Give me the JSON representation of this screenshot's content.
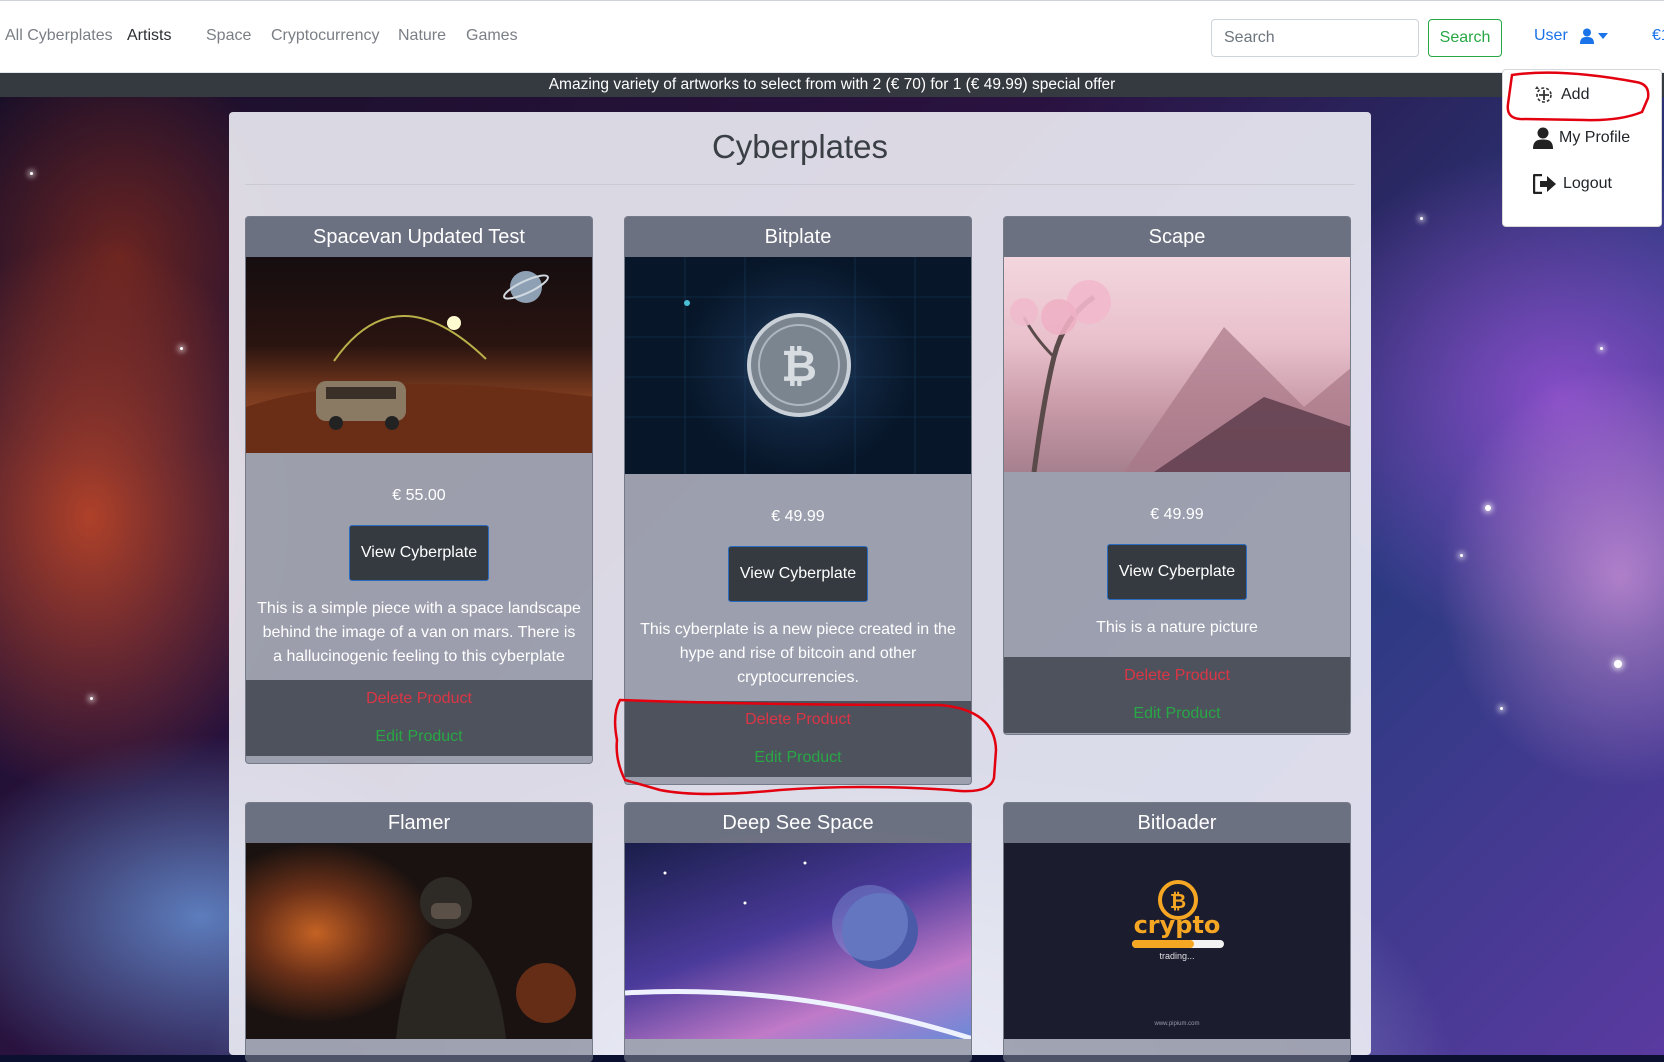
{
  "navbar": {
    "links": [
      {
        "label": "All Cyberplates",
        "active": false
      },
      {
        "label": "Artists",
        "active": true
      },
      {
        "label": "Space",
        "active": false
      },
      {
        "label": "Cryptocurrency",
        "active": false
      },
      {
        "label": "Nature",
        "active": false
      },
      {
        "label": "Games",
        "active": false
      }
    ],
    "search_placeholder": "Search",
    "search_button": "Search",
    "user_label": "User",
    "currency_cut": "€1"
  },
  "banner": {
    "text": "Amazing variety of artworks to select from with 2 (€ 70) for 1 (€ 49.99) special offer"
  },
  "main": {
    "title": "Cyberplates",
    "products": [
      {
        "name": "Spacevan Updated Test",
        "price": "€ 55.00",
        "view_label": "View Cyberplate",
        "description": "This is a simple piece with a space landscape behind the image of a van on mars. There is a hallucinogenic feeling to this cyberplate",
        "delete_label": "Delete Product",
        "edit_label": "Edit Product"
      },
      {
        "name": "Bitplate",
        "price": "€ 49.99",
        "view_label": "View Cyberplate",
        "description": "This cyberplate is a new piece created in the hype and rise of bitcoin and other cryptocurrencies.",
        "delete_label": "Delete Product",
        "edit_label": "Edit Product"
      },
      {
        "name": "Scape",
        "price": "€ 49.99",
        "view_label": "View Cyberplate",
        "description": "This is a nature picture",
        "delete_label": "Delete Product",
        "edit_label": "Edit Product"
      },
      {
        "name": "Flamer"
      },
      {
        "name": "Deep See Space"
      },
      {
        "name": "Bitloader",
        "logo_text": "crypto",
        "logo_sub": "trading...",
        "logo_url": "www.pipium.com"
      }
    ]
  },
  "dropdown": {
    "items": [
      {
        "label": "Add",
        "icon": "add-icon"
      },
      {
        "label": "My Profile",
        "icon": "user-icon"
      },
      {
        "label": "Logout",
        "icon": "logout-icon"
      }
    ]
  },
  "colors": {
    "success": "#28a745",
    "danger": "#dc3545",
    "primary": "#1a73e8",
    "banner_bg": "#343a40",
    "annotation": "#e3000f"
  }
}
